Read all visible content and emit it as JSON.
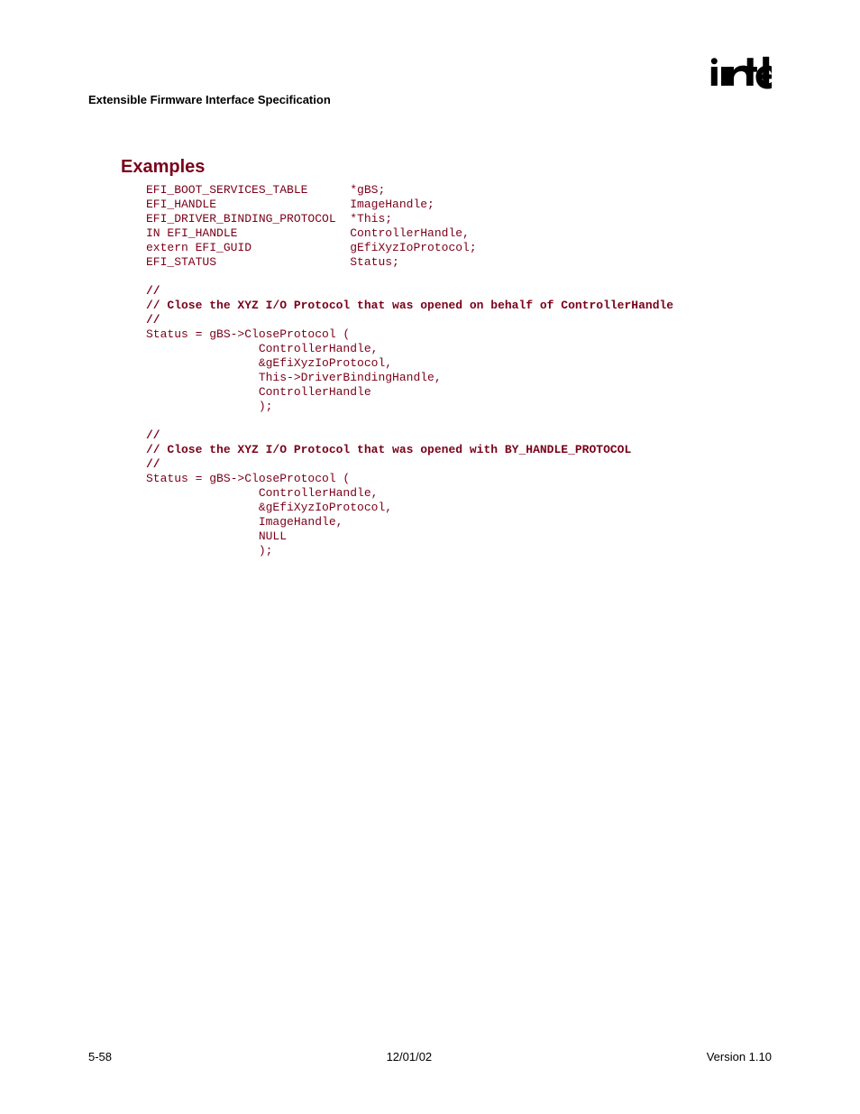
{
  "header": {
    "title": "Extensible Firmware Interface Specification"
  },
  "heading": "Examples",
  "code": {
    "line01": "EFI_BOOT_SERVICES_TABLE      *gBS;",
    "line02": "EFI_HANDLE                   ImageHandle;",
    "line03": "EFI_DRIVER_BINDING_PROTOCOL  *This;",
    "line04": "IN EFI_HANDLE                ControllerHandle,",
    "line05": "extern EFI_GUID              gEfiXyzIoProtocol;",
    "line06": "EFI_STATUS                   Status;",
    "line07": "",
    "line08": "//",
    "line09": "// Close the XYZ I/O Protocol that was opened on behalf of ControllerHandle",
    "line10": "//",
    "line11": "Status = gBS->CloseProtocol (",
    "line12": "                ControllerHandle,",
    "line13": "                &gEfiXyzIoProtocol,",
    "line14": "                This->DriverBindingHandle,",
    "line15": "                ControllerHandle",
    "line16": "                );",
    "line17": "",
    "line18": "//",
    "line19": "// Close the XYZ I/O Protocol that was opened with BY_HANDLE_PROTOCOL",
    "line20": "//",
    "line21": "Status = gBS->CloseProtocol (",
    "line22": "                ControllerHandle,",
    "line23": "                &gEfiXyzIoProtocol,",
    "line24": "                ImageHandle,",
    "line25": "                NULL",
    "line26": "                );"
  },
  "footer": {
    "left": "5-58",
    "center": "12/01/02",
    "right": "Version 1.10"
  }
}
